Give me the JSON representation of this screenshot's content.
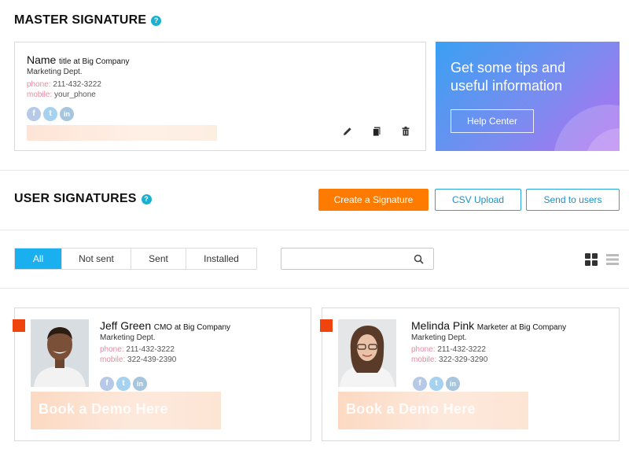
{
  "master": {
    "title": "MASTER SIGNATURE",
    "help": "?",
    "signature": {
      "name": "Name",
      "title_line": "title at Big Company",
      "dept": "Marketing Dept.",
      "phone_label": "phone:",
      "phone": "211-432-3222",
      "mobile_label": "mobile:",
      "mobile": "your_phone"
    },
    "icons": [
      "pencil-icon",
      "copy-icon",
      "trash-icon"
    ]
  },
  "promo": {
    "line1": "Get some tips and",
    "line2": "useful information",
    "button": "Help Center"
  },
  "users": {
    "title": "USER SIGNATURES",
    "help": "?",
    "create_button": "Create a Signature",
    "csv_button": "CSV Upload",
    "send_button": "Send to users"
  },
  "filters": {
    "tabs": [
      {
        "label": "All",
        "active": true
      },
      {
        "label": "Not sent",
        "active": false
      },
      {
        "label": "Sent",
        "active": false
      },
      {
        "label": "Installed",
        "active": false
      }
    ],
    "search_value": "",
    "search_placeholder": ""
  },
  "social": {
    "facebook": "f",
    "twitter": "t",
    "linkedin": "in"
  },
  "cards": [
    {
      "name": "Jeff Green",
      "title_line": "CMO at Big Company",
      "dept": "Marketing Dept.",
      "phone_label": "phone:",
      "phone": "211-432-3222",
      "mobile_label": "mobile:",
      "mobile": "322-439-2390",
      "banner": "Book a Demo Here"
    },
    {
      "name": "Melinda Pink",
      "title_line": "Marketer at Big Company",
      "dept": "Marketing Dept.",
      "phone_label": "phone:",
      "phone": "211-432-3222",
      "mobile_label": "mobile:",
      "mobile": "322-329-3290",
      "banner": "Book a Demo Here"
    }
  ],
  "colors": {
    "accent": "#1ab0f0",
    "orange": "#ff7b00",
    "flag": "#f0440f"
  }
}
